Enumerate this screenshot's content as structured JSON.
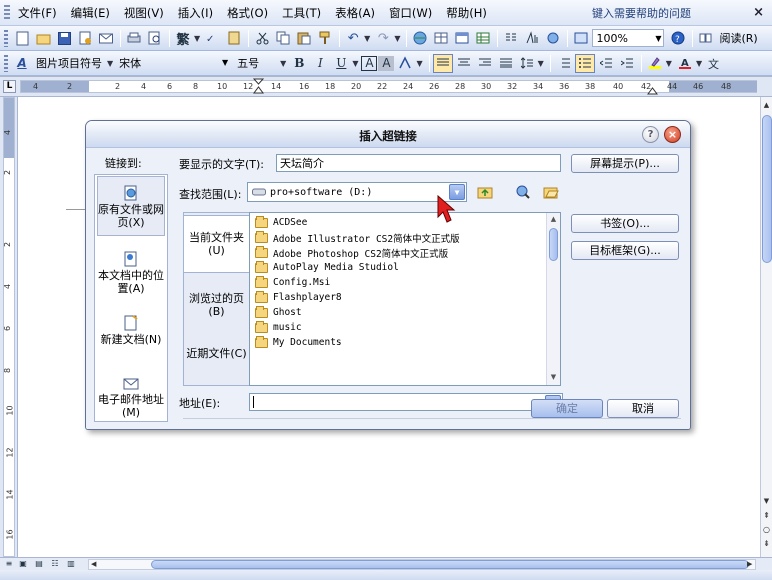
{
  "menu": {
    "items": [
      "文件(F)",
      "编辑(E)",
      "视图(V)",
      "插入(I)",
      "格式(O)",
      "工具(T)",
      "表格(A)",
      "窗口(W)",
      "帮助(H)"
    ],
    "help_prompt": "键入需要帮助的问题",
    "close_glyph": "×"
  },
  "toolbar": {
    "zoom": "100%",
    "read_label": "阅读(R)",
    "traditional_label": "繁"
  },
  "format_bar": {
    "style": "图片项目符号",
    "font": "宋体",
    "size": "五号",
    "bold": "B",
    "italic": "I",
    "underline": "U",
    "char_border": "A",
    "char_shade": "A"
  },
  "ruler": {
    "corner": "L",
    "ticks": [
      "4",
      "2",
      "2",
      "4",
      "6",
      "8",
      "10",
      "12",
      "14",
      "16",
      "18",
      "20",
      "22",
      "24",
      "26",
      "28",
      "30",
      "32",
      "34",
      "36",
      "38",
      "40",
      "42",
      "44",
      "46",
      "48"
    ],
    "vticks": [
      "4",
      "2",
      "2",
      "4",
      "6",
      "8",
      "10",
      "12",
      "14",
      "16"
    ]
  },
  "dialog": {
    "title": "插入超链接",
    "help_glyph": "?",
    "close_glyph": "×",
    "link_to_label": "链接到:",
    "display_text_label": "要显示的文字(T):",
    "display_text_value": "天坛简介",
    "screen_tip_button": "屏幕提示(P)...",
    "look_in_label": "查找范围(L):",
    "look_in_value": "pro+software (D:)",
    "bookmark_button": "书签(O)...",
    "target_frame_button": "目标框架(G)...",
    "address_label": "地址(E):",
    "address_value": "",
    "ok_button": "确定",
    "cancel_button": "取消",
    "link_targets": [
      {
        "label": "原有文件或网页(X)",
        "icon": "globe-file-icon",
        "selected": true
      },
      {
        "label": "本文档中的位置(A)",
        "icon": "document-place-icon",
        "selected": false
      },
      {
        "label": "新建文档(N)",
        "icon": "new-document-icon",
        "selected": false
      },
      {
        "label": "电子邮件地址(M)",
        "icon": "email-icon",
        "selected": false
      }
    ],
    "scopes": [
      {
        "label": "当前文件夹(U)",
        "selected": true
      },
      {
        "label": "浏览过的页(B)",
        "selected": false
      },
      {
        "label": "近期文件(C)",
        "selected": false
      }
    ],
    "files": [
      "ACDSee",
      "Adobe Illustrator CS2简体中文正式版",
      "Adobe Photoshop CS2简体中文正式版",
      "AutoPlay Media Studiol",
      "Config.Msi",
      "Flashplayer8",
      "Ghost",
      "music",
      "My Documents"
    ]
  },
  "colors": {
    "titlebar_blue": "#ccd9f0",
    "close_red": "#d23f22",
    "cursor_red": "#e02020",
    "folder_yellow": "#f5d57d"
  }
}
